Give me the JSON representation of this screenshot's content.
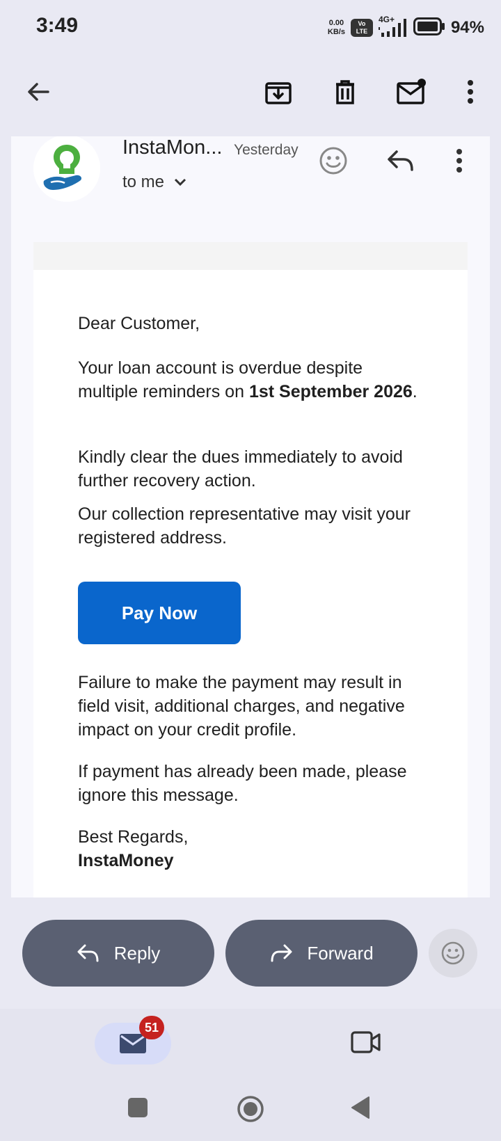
{
  "status_bar": {
    "time": "3:49",
    "net_speed_value": "0.00",
    "net_speed_unit": "KB/s",
    "volte_top": "Vo",
    "volte_bottom": "LTE",
    "network": "4G+",
    "battery": "94%"
  },
  "email": {
    "sender": "InstaMon...",
    "date": "Yesterday",
    "recipient": "to me",
    "greeting": "Dear Customer,",
    "para1_prefix": "Your loan account is overdue despite multiple reminders on ",
    "para1_bold": "1st September 2026",
    "para1_suffix": ".",
    "para2": "Kindly clear the dues immediately to avoid further recovery action.",
    "para3": "Our collection representative may visit your registered address.",
    "cta": "Pay Now",
    "para4": "Failure to make the payment may result in field visit, additional charges, and negative impact on your credit profile.",
    "para5": "If payment has already been made, please ignore this message.",
    "signoff": "Best Regards,",
    "signature": "InstaMoney"
  },
  "actions": {
    "reply": "Reply",
    "forward": "Forward"
  },
  "bottom_nav": {
    "mail_badge": "51"
  },
  "colors": {
    "accent_button": "#0a66cc",
    "pill": "#5a6072",
    "badge": "#c5221f"
  },
  "icons": {
    "toolbar": [
      "back-arrow-icon",
      "archive-icon",
      "delete-icon",
      "mark-unread-icon",
      "more-vert-icon"
    ],
    "header": [
      "emoji-icon",
      "reply-icon",
      "more-vert-icon"
    ],
    "nav": [
      "mail-icon",
      "video-icon"
    ]
  }
}
